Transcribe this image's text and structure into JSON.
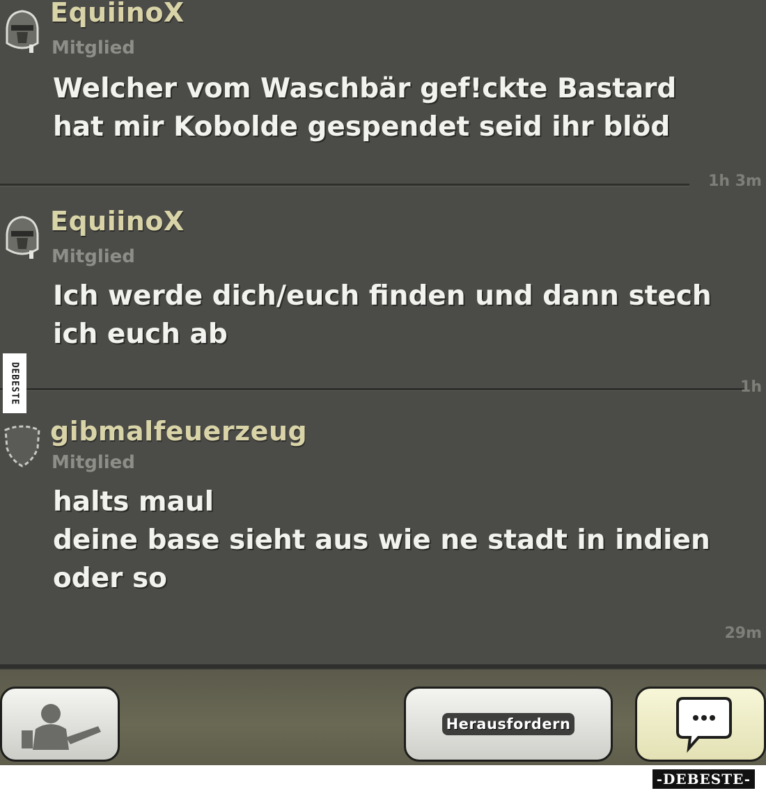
{
  "messages": [
    {
      "author": "EquiinoX",
      "role": "Mitglied",
      "text": "Welcher vom Waschbär gef!ckte Bastard\nhat mir Kobolde gespendet seid ihr blöd",
      "time": "1h 3m",
      "avatar_icon": "helmet-avatar-icon"
    },
    {
      "author": "EquiinoX",
      "role": "Mitglied",
      "text": "Ich werde dich/euch finden und dann stech\nich euch ab",
      "time": "1h",
      "avatar_icon": "helmet-avatar-icon"
    },
    {
      "author": "gibmalfeuerzeug",
      "role": "Mitglied",
      "text": "halts maul\ndeine base sieht aus wie ne stadt in indien\noder so",
      "time": "29m",
      "avatar_icon": "empty-shield-avatar-icon"
    }
  ],
  "bottom_bar": {
    "challenge_label": "Herausfordern",
    "back_icon": "barbarian-icon",
    "chat_icon": "speech-bubble-icon"
  },
  "watermarks": {
    "side": "DEBESTE",
    "footer": "-DEBESTE-"
  },
  "colors": {
    "chat_background": "#4b4b48",
    "author_name": "#d9d4a8",
    "message_text": "#f2f2ee",
    "role_text": "#8e8e89"
  }
}
